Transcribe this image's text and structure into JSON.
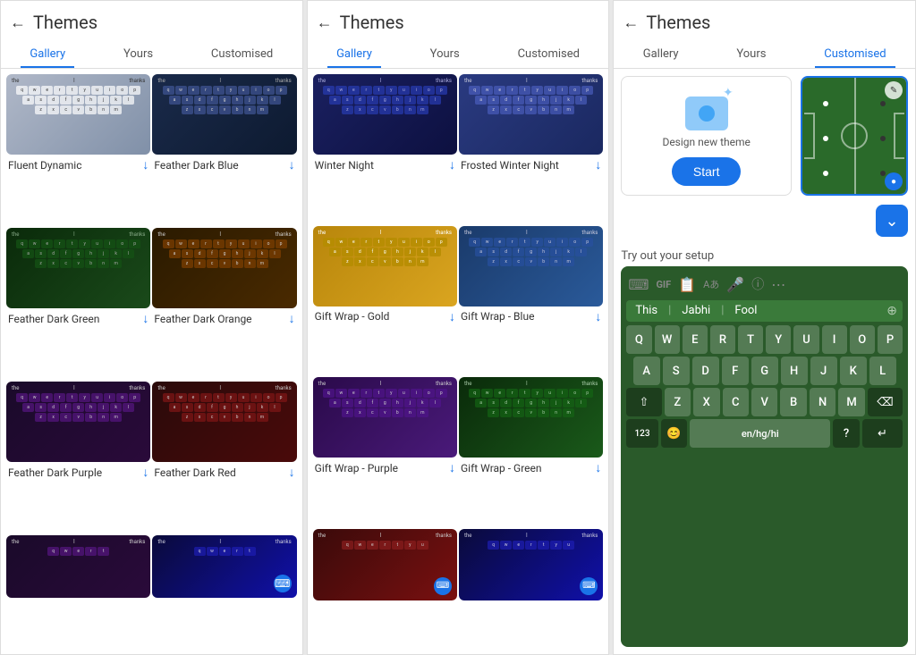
{
  "panels": [
    {
      "title": "Themes",
      "tabs": [
        "Gallery",
        "Yours",
        "Customised"
      ],
      "active_tab": "Gallery",
      "themes": [
        {
          "label": "Fluent Dynamic",
          "style": "fluent-dynamic"
        },
        {
          "label": "Feather Dark Blue",
          "style": "feather-dark-blue"
        },
        {
          "label": "Feather Dark Green",
          "style": "feather-dark-green"
        },
        {
          "label": "Feather Dark Orange",
          "style": "feather-dark-orange"
        },
        {
          "label": "Feather Dark Purple",
          "style": "feather-dark-purple"
        },
        {
          "label": "Feather Dark Red",
          "style": "feather-dark-red"
        }
      ]
    },
    {
      "title": "Themes",
      "tabs": [
        "Gallery",
        "Yours",
        "Customised"
      ],
      "active_tab": "Gallery",
      "themes": [
        {
          "label": "Winter Night",
          "style": "winter-night"
        },
        {
          "label": "Frosted Winter Night",
          "style": "frosted-winter"
        },
        {
          "label": "Gift Wrap - Gold",
          "style": "gift-gold"
        },
        {
          "label": "Gift Wrap - Blue",
          "style": "gift-blue"
        },
        {
          "label": "Gift Wrap - Purple",
          "style": "gift-purple"
        },
        {
          "label": "Gift Wrap - Green",
          "style": "gift-green"
        },
        {
          "label": "",
          "style": "extra1"
        },
        {
          "label": "",
          "style": "extra2"
        }
      ]
    },
    {
      "title": "Themes",
      "tabs": [
        "Gallery",
        "Yours",
        "Customised"
      ],
      "active_tab": "Customised",
      "design_label": "Design new theme",
      "start_btn": "Start",
      "try_label": "Try out your setup",
      "suggestions": [
        "This",
        "Jabhi",
        "Fool"
      ],
      "keyboard_rows": [
        [
          "Q",
          "W",
          "E",
          "R",
          "T",
          "Y",
          "U",
          "I",
          "O",
          "P"
        ],
        [
          "A",
          "S",
          "D",
          "F",
          "G",
          "H",
          "J",
          "K",
          "L"
        ],
        [
          "Z",
          "X",
          "C",
          "V",
          "B",
          "N",
          "M"
        ],
        [
          "123",
          "en/hg/hi"
        ]
      ]
    }
  ],
  "keyboard_keys": {
    "row1": [
      "Q",
      "W",
      "E",
      "R",
      "T",
      "Y",
      "U",
      "I",
      "O",
      "P"
    ],
    "row2": [
      "A",
      "S",
      "D",
      "F",
      "G",
      "H",
      "J",
      "K",
      "L"
    ],
    "row3": [
      "Z",
      "X",
      "C",
      "V",
      "B",
      "N",
      "M"
    ],
    "space": "en/hg/hi"
  },
  "icons": {
    "back": "←",
    "download": "↓",
    "chevron_down": "⌄",
    "edit": "✎",
    "radio_selected": "●",
    "sparkle": "✦"
  }
}
